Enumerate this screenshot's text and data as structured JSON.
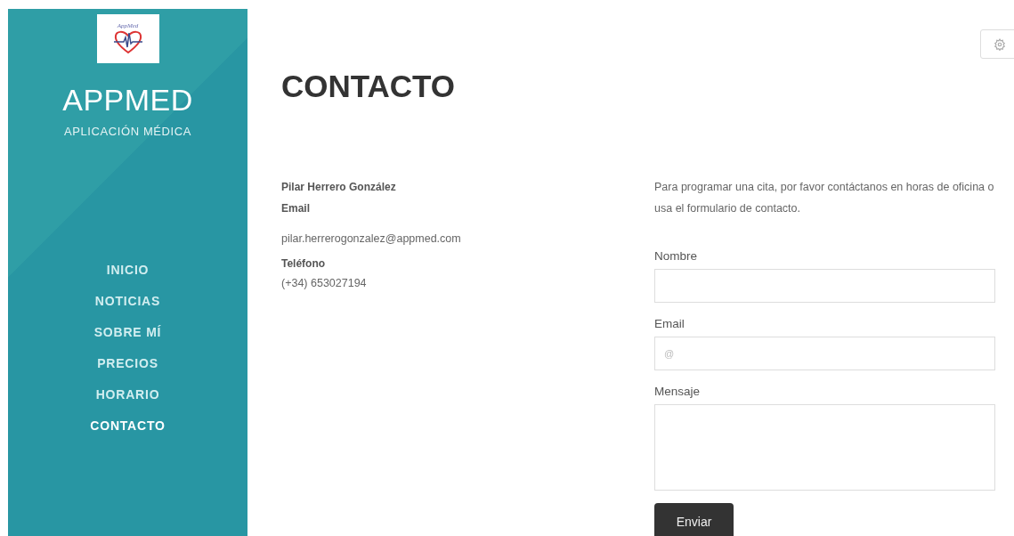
{
  "sidebar": {
    "logo": {
      "text": "AppMed"
    },
    "brand": "APPMED",
    "tagline": "APLICACIÓN MÉDICA",
    "nav": [
      {
        "label": "INICIO",
        "selected": false
      },
      {
        "label": "NOTICIAS",
        "selected": false
      },
      {
        "label": "SOBRE MÍ",
        "selected": false
      },
      {
        "label": "PRECIOS",
        "selected": false
      },
      {
        "label": "HORARIO",
        "selected": false
      },
      {
        "label": "CONTACTO",
        "selected": true
      }
    ]
  },
  "page": {
    "title": "CONTACTO",
    "contact": {
      "name": "Pilar Herrero González",
      "email_label": "Email",
      "email": "pilar.herrerogonzalez@appmed.com",
      "phone_label": "Teléfono",
      "phone": "(+34) 653027194"
    },
    "intro": "Para programar una cita, por favor contáctanos en horas de oficina o usa el formulario de contacto.",
    "form": {
      "fields": [
        {
          "kind": "input",
          "label": "Nombre"
        },
        {
          "kind": "input",
          "label": "Email",
          "placeholder": "@"
        },
        {
          "kind": "textarea",
          "label": "Mensaje"
        }
      ],
      "submit": "Enviar"
    }
  }
}
